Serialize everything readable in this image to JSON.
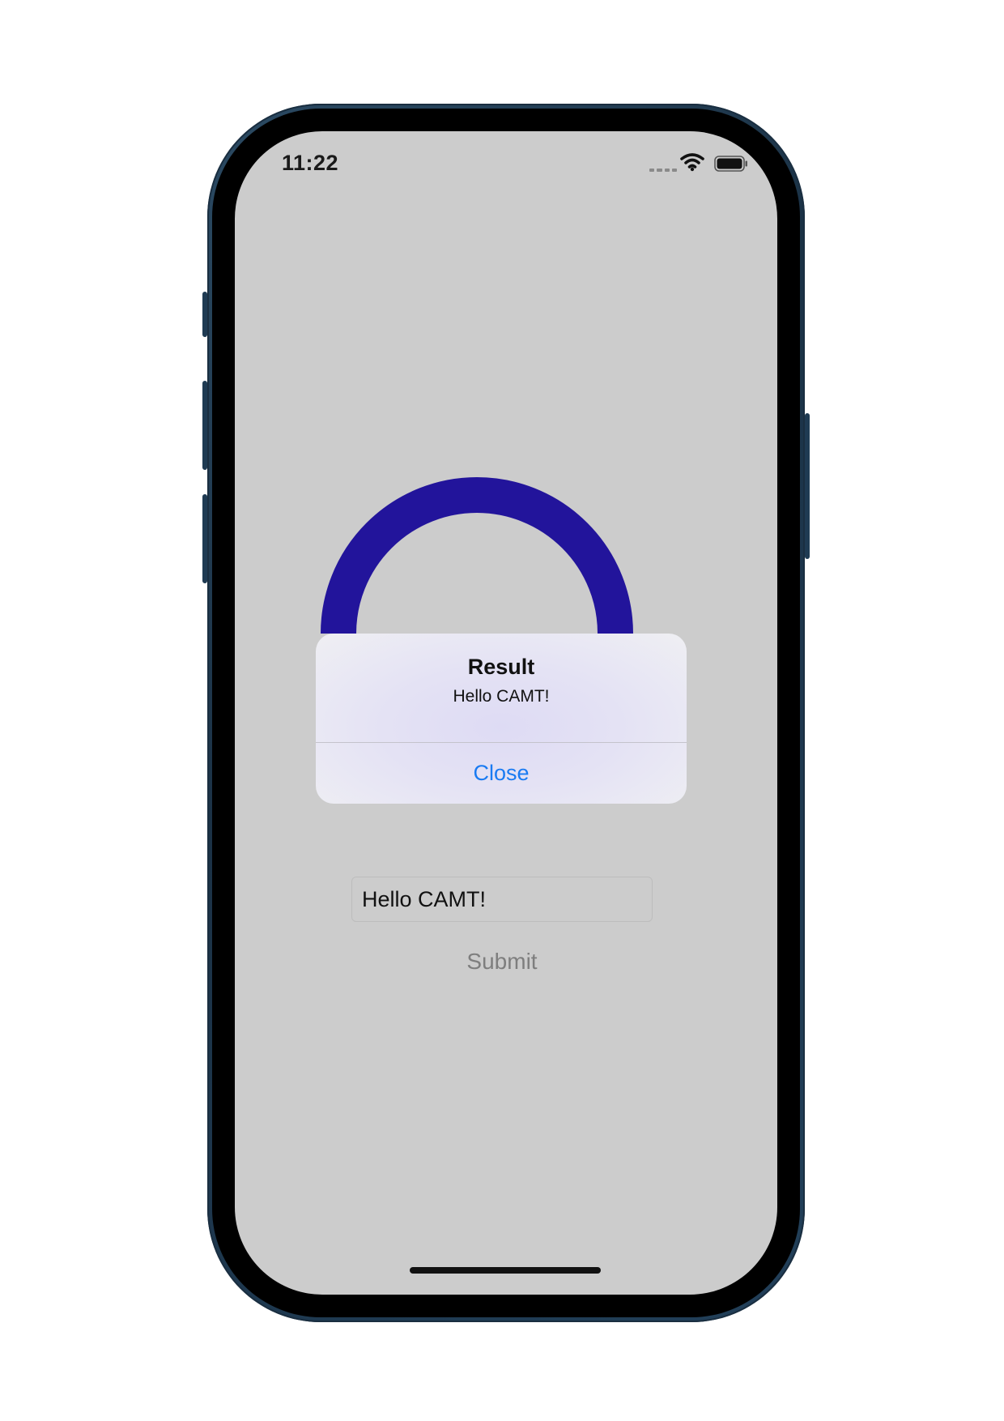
{
  "status_bar": {
    "time": "11:22",
    "wifi_icon": "wifi-icon",
    "battery_icon": "battery-icon"
  },
  "colors": {
    "background": "#cccccc",
    "arc": "#22149b",
    "alert_button": "#1a7bf2",
    "submit_text": "#7e7e7e"
  },
  "alert": {
    "title": "Result",
    "message": "Hello CAMT!",
    "button_label": "Close"
  },
  "form": {
    "input_value": "Hello CAMT!",
    "submit_label": "Submit"
  }
}
